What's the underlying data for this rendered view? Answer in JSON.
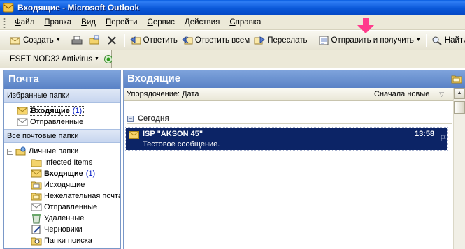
{
  "window": {
    "title": "Входящие - Microsoft Outlook"
  },
  "menu": {
    "items": [
      {
        "underlined": "Ф",
        "rest": "айл"
      },
      {
        "underlined": "П",
        "rest": "равка"
      },
      {
        "underlined": "В",
        "rest": "ид"
      },
      {
        "underlined": "П",
        "rest": "ерейти"
      },
      {
        "underlined": "С",
        "rest": "ервис"
      },
      {
        "underlined": "Д",
        "rest": "ействия"
      },
      {
        "underlined": "С",
        "rest": "правка"
      }
    ]
  },
  "toolbar": {
    "new_label": "Создать",
    "reply_label": "Ответить",
    "reply_all_label": "Ответить всем",
    "forward_label": "Переслать",
    "send_receive_label": "Отправить и получить",
    "find_label": "Найти"
  },
  "eset_toolbar": {
    "label": "ESET NOD32 Antivirus"
  },
  "nav": {
    "header": "Почта",
    "favorites_title": "Избранные папки",
    "favorites": [
      {
        "name": "Входящие",
        "count": "(1)",
        "bold": true,
        "selected": true,
        "icon": "inbox-icon"
      },
      {
        "name": "Отправленные",
        "count": "",
        "bold": false,
        "icon": "sent-icon"
      }
    ],
    "all_folders_title": "Все почтовые папки",
    "root": {
      "name": "Личные папки",
      "icon": "personal-folders-icon"
    },
    "folders": [
      {
        "name": "Infected Items",
        "count": "",
        "bold": false,
        "icon": "folder-icon"
      },
      {
        "name": "Входящие",
        "count": "(1)",
        "bold": true,
        "icon": "inbox-icon"
      },
      {
        "name": "Исходящие",
        "count": "",
        "bold": false,
        "icon": "outbox-icon"
      },
      {
        "name": "Нежелательная почта",
        "count": "",
        "bold": false,
        "icon": "junk-folder-icon"
      },
      {
        "name": "Отправленные",
        "count": "",
        "bold": false,
        "icon": "sent-icon"
      },
      {
        "name": "Удаленные",
        "count": "",
        "bold": false,
        "icon": "deleted-icon"
      },
      {
        "name": "Черновики",
        "count": "",
        "bold": false,
        "icon": "drafts-icon"
      },
      {
        "name": "Папки поиска",
        "count": "",
        "bold": false,
        "icon": "search-folder-icon"
      }
    ]
  },
  "inbox": {
    "header": "Входящие",
    "arrange_label": "Упорядочение: Дата",
    "order_label": "Сначала новые",
    "group_label": "Сегодня",
    "messages": [
      {
        "from": "ISP \"AKSON 45\"",
        "subject": "Тестовое сообщение.",
        "time": "13:58",
        "selected": true
      }
    ]
  },
  "colors": {
    "title_bar": "#0a58d8",
    "pane_header": "#6e94d2",
    "selection": "#0c2466",
    "unread_count": "#0018c8",
    "annotation_arrow": "#ff3c8c"
  }
}
